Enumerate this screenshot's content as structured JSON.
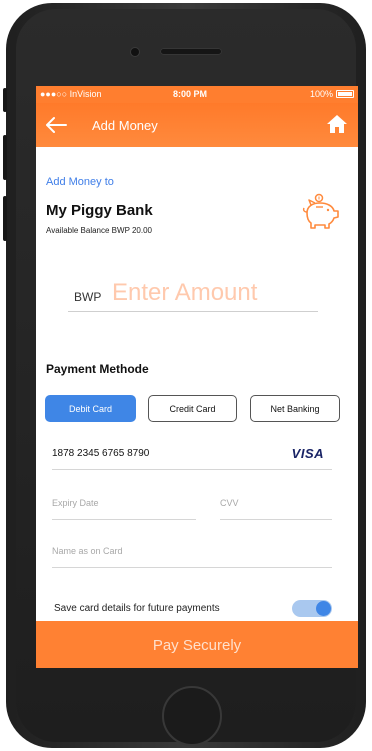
{
  "status": {
    "carrier": "●●●○○ InVision",
    "time": "8:00 PM",
    "battery": "100%"
  },
  "header": {
    "title": "Add Money",
    "back_icon": "back-arrow-icon",
    "home_icon": "home-icon"
  },
  "account": {
    "add_to_label": "Add Money to",
    "name": "My Piggy Bank",
    "balance": "Available Balance BWP 20.00",
    "icon": "piggy-bank-icon"
  },
  "amount": {
    "currency": "BWP",
    "placeholder": "Enter Amount",
    "value": ""
  },
  "payment": {
    "title": "Payment Methode",
    "methods": [
      "Debit Card",
      "Credit Card",
      "Net Banking"
    ],
    "selected": "Debit Card"
  },
  "card": {
    "number": "1878 2345 6765 8790",
    "brand": "VISA",
    "expiry_placeholder": "Expiry Date",
    "cvv_placeholder": "CVV",
    "name_placeholder": "Name as on Card"
  },
  "save": {
    "label": "Save card details for future payments",
    "enabled": true
  },
  "pay_button": "Pay Securely",
  "colors": {
    "accent": "#ff7e2f",
    "primary_blue": "#3f86e6"
  }
}
